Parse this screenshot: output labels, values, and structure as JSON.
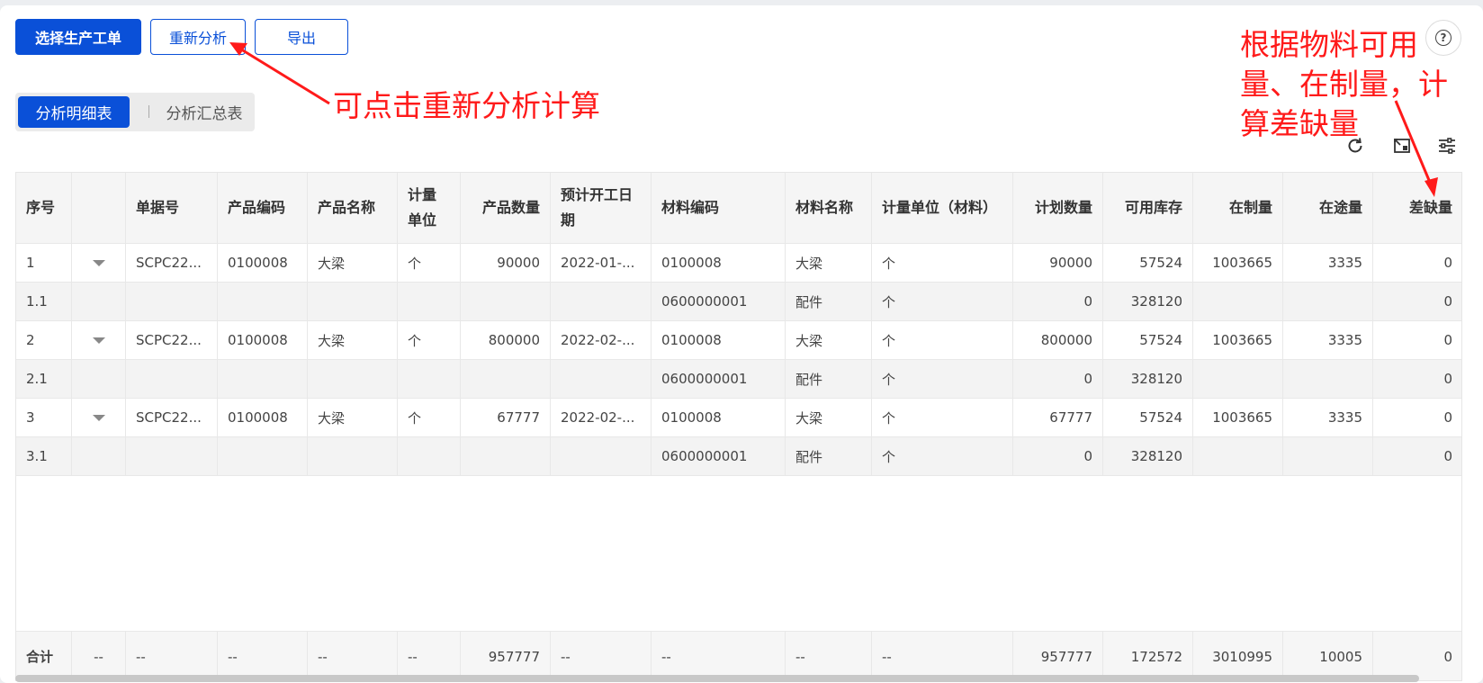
{
  "toolbar": {
    "select_order": "选择生产工单",
    "reanalyze": "重新分析",
    "export": "导出"
  },
  "help_icon_glyph": "?",
  "tabs": [
    "分析明细表",
    "分析汇总表"
  ],
  "annotations": {
    "reanalyze_note": "可点击重新分析计算",
    "shortage_note": [
      "根据物料可用",
      "量、在制量，计",
      "算差缺量"
    ]
  },
  "columns": [
    "序号",
    "",
    "单据号",
    "产品编码",
    "产品名称",
    "计量单位",
    "产品数量",
    "预计开工日期",
    "材料编码",
    "材料名称",
    "计量单位（材料）",
    "计划数量",
    "可用库存",
    "在制量",
    "在途量",
    "差缺量"
  ],
  "rows": [
    {
      "type": "parent",
      "cells": [
        "1",
        "",
        "SCPC22...",
        "0100008",
        "大梁",
        "个",
        "90000",
        "2022-01-...",
        "0100008",
        "大梁",
        "个",
        "90000",
        "57524",
        "1003665",
        "3335",
        "0"
      ]
    },
    {
      "type": "child",
      "cells": [
        "1.1",
        "",
        "",
        "",
        "",
        "",
        "",
        "",
        "0600000001",
        "配件",
        "个",
        "0",
        "328120",
        "",
        "",
        "0"
      ]
    },
    {
      "type": "parent",
      "cells": [
        "2",
        "",
        "SCPC22...",
        "0100008",
        "大梁",
        "个",
        "800000",
        "2022-02-...",
        "0100008",
        "大梁",
        "个",
        "800000",
        "57524",
        "1003665",
        "3335",
        "0"
      ]
    },
    {
      "type": "child",
      "cells": [
        "2.1",
        "",
        "",
        "",
        "",
        "",
        "",
        "",
        "0600000001",
        "配件",
        "个",
        "0",
        "328120",
        "",
        "",
        "0"
      ]
    },
    {
      "type": "parent",
      "cells": [
        "3",
        "",
        "SCPC22...",
        "0100008",
        "大梁",
        "个",
        "67777",
        "2022-02-...",
        "0100008",
        "大梁",
        "个",
        "67777",
        "57524",
        "1003665",
        "3335",
        "0"
      ]
    },
    {
      "type": "child",
      "cells": [
        "3.1",
        "",
        "",
        "",
        "",
        "",
        "",
        "",
        "0600000001",
        "配件",
        "个",
        "0",
        "328120",
        "",
        "",
        "0"
      ]
    }
  ],
  "totals": [
    "合计",
    "--",
    "--",
    "--",
    "--",
    "--",
    "957777",
    "--",
    "--",
    "--",
    "--",
    "957777",
    "172572",
    "3010995",
    "10005",
    "0"
  ],
  "colors": {
    "primary": "#0a50d8",
    "annotation": "#ff1a1a"
  },
  "icons": {
    "refresh": "refresh-icon",
    "fullscreen": "fullscreen-icon",
    "settings": "column-settings-icon",
    "expand": "caret-down-icon"
  }
}
